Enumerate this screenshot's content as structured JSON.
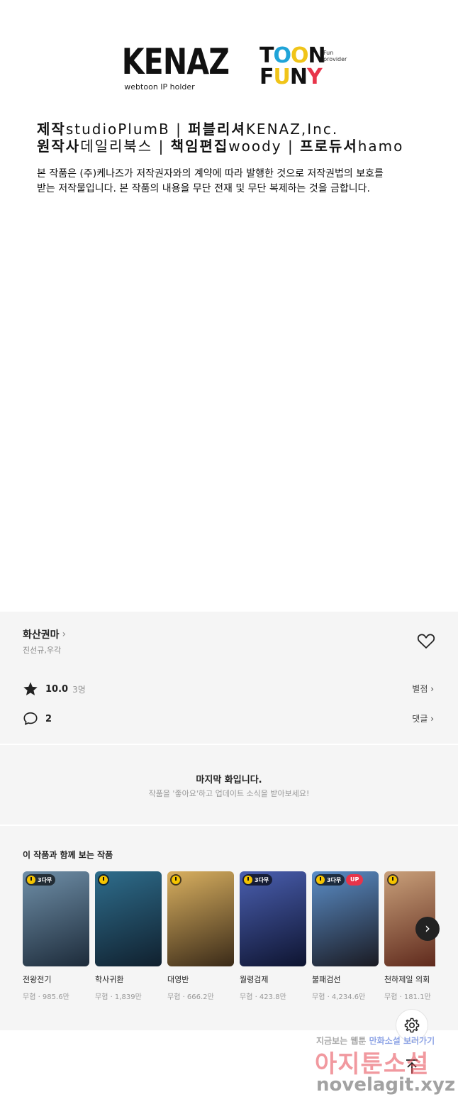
{
  "credit": {
    "kenaz_logo": "KENAZ",
    "kenaz_sub": "webtoon IP holder",
    "toonfuny": {
      "row1": [
        "T",
        "O",
        "O",
        "N"
      ],
      "row2": [
        "F",
        "U",
        "N",
        "Y"
      ],
      "tagline": "Fun provider"
    },
    "line1": {
      "k1": "제작",
      "v1": "studioPlumB",
      "sep": "|",
      "k2": "퍼블리셔",
      "v2": "KENAZ,Inc."
    },
    "line2": {
      "k1": "원작사",
      "v1": "데일리북스",
      "sep": "|",
      "k2": "책임편집",
      "v2": "woody",
      "sep2": "|",
      "k3": "프로듀서",
      "v3": "hamo"
    },
    "notice1": "본 작품은 (주)케나즈가 저작권자와의 계약에 따라 발행한 것으로 저작권법의 보호를",
    "notice2": "받는 저작물입니다. 본 작품의 내용을 무단 전재 및 무단 복제하는 것을 금합니다."
  },
  "series": {
    "title": "화산권마",
    "chevron": "›",
    "authors": "진선규,우각",
    "rating": "10.0",
    "voters": "3명",
    "rate_link": "별점 ›",
    "comments": "2",
    "comment_link": "댓글 ›"
  },
  "last_episode": {
    "title": "마지막 화입니다.",
    "subtitle": "작품을 '좋아요'하고 업데이트 소식을 받아보세요!"
  },
  "recommendations": {
    "heading": "이 작품과 함께 보는 작품",
    "next": "›",
    "items": [
      {
        "title": "전왕전기",
        "meta": "무협 · 985.6만",
        "badge": "3다무",
        "up": "",
        "colors": [
          "#6f8fa8",
          "#1d2b3a"
        ]
      },
      {
        "title": "학사귀환",
        "meta": "무협 · 1,839만",
        "badge": "",
        "up": "",
        "colors": [
          "#2e6d8c",
          "#10202e"
        ]
      },
      {
        "title": "대영반",
        "meta": "무협 · 666.2만",
        "badge": "",
        "up": "",
        "colors": [
          "#d9b060",
          "#3a2a18"
        ]
      },
      {
        "title": "월령검제",
        "meta": "무협 · 423.8만",
        "badge": "3다무",
        "up": "",
        "colors": [
          "#4a5fb0",
          "#0e1430"
        ]
      },
      {
        "title": "불패검선",
        "meta": "무협 · 4,234.6만",
        "badge": "3다무",
        "up": "UP",
        "colors": [
          "#5b8ec8",
          "#1a1a22"
        ]
      },
      {
        "title": "천하제일 의회",
        "meta": "무협 · 181.1만",
        "badge": "",
        "up": "",
        "colors": [
          "#c9a07a",
          "#5a2418"
        ]
      }
    ]
  },
  "watermark": {
    "line1_a": "지금보는 웹툰",
    "line1_b": "만화소설",
    "line1_c": "보러가기",
    "line2": "아지툰소설",
    "line3": "novelagit.xyz"
  }
}
